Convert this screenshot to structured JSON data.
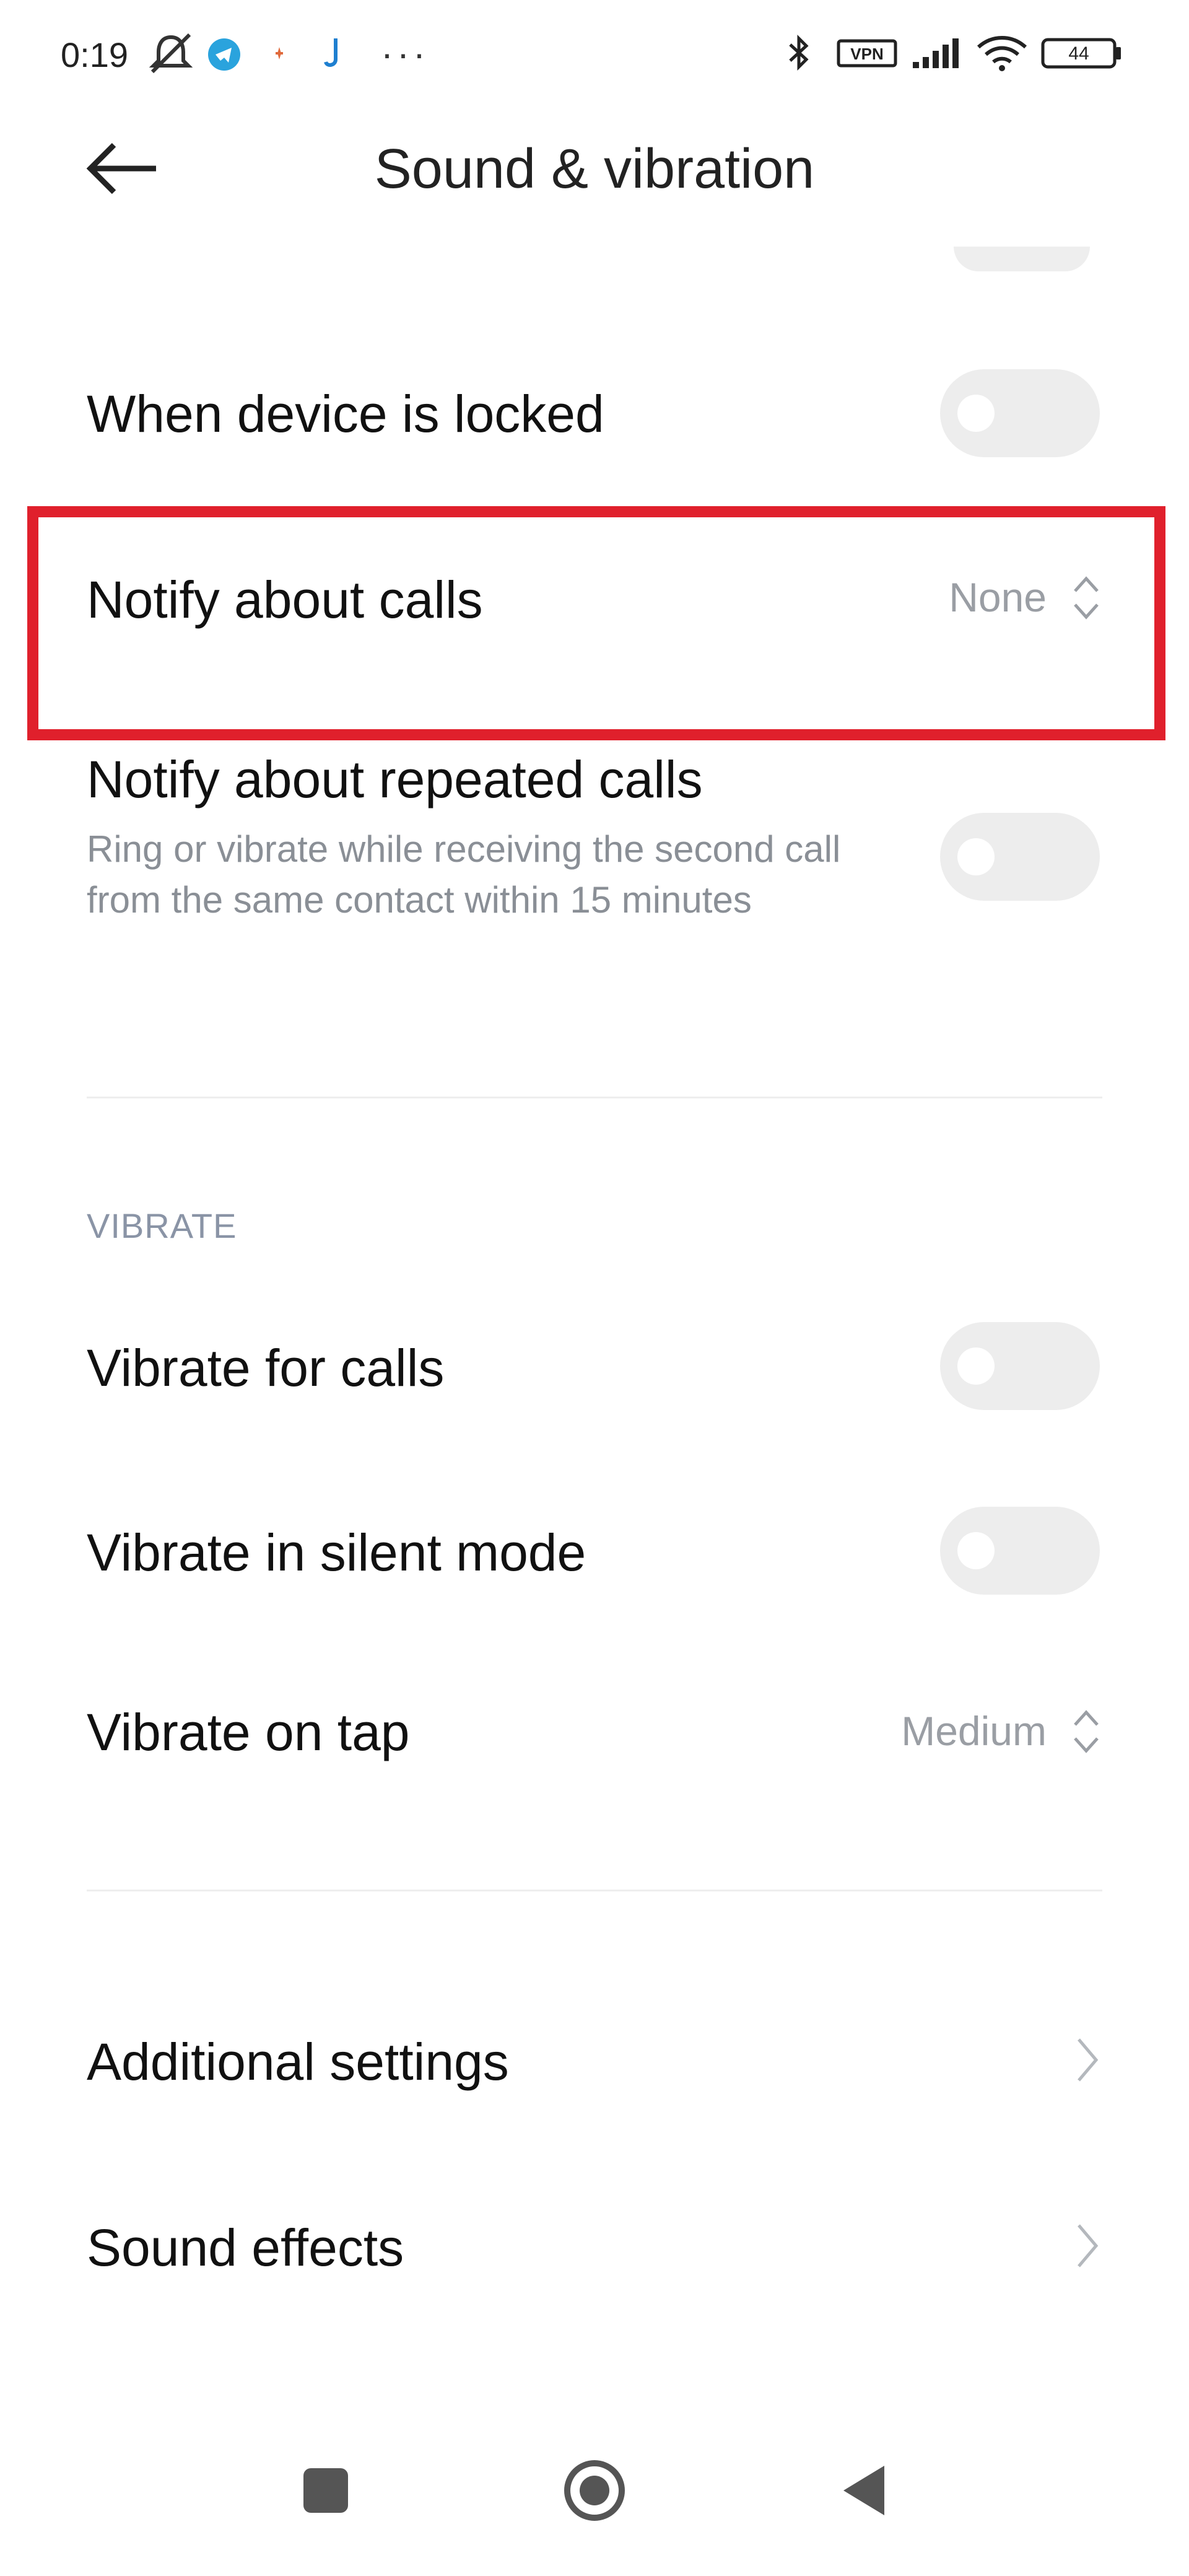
{
  "status_bar": {
    "time": "0:19",
    "vpn": "VPN",
    "battery": "44"
  },
  "header": {
    "title": "Sound & vibration"
  },
  "rows": {
    "when_locked": {
      "title": "When device is locked",
      "enabled": false
    },
    "notify_calls": {
      "title": "Notify about calls",
      "value": "None"
    },
    "notify_repeated": {
      "title": "Notify about repeated calls",
      "description": "Ring or vibrate while receiving the second call from the same contact within 15 minutes",
      "enabled": false
    }
  },
  "vibrate": {
    "section_label": "VIBRATE",
    "vibrate_calls": {
      "title": "Vibrate for calls",
      "enabled": false
    },
    "vibrate_silent": {
      "title": "Vibrate in silent mode",
      "enabled": false
    },
    "vibrate_tap": {
      "title": "Vibrate on tap",
      "value": "Medium"
    }
  },
  "more": {
    "additional": "Additional settings",
    "sound_effects": "Sound effects"
  },
  "colors": {
    "highlight": "#e0202c",
    "toggle_off": "#ededed",
    "secondary_text": "#9a9ea4"
  },
  "icons": [
    "mute-bell-icon",
    "telegram-icon",
    "notification-dot-icon",
    "music-note-icon",
    "more-dots-icon",
    "bluetooth-icon",
    "vpn-icon",
    "signal-icon",
    "wifi-icon",
    "battery-icon",
    "back-arrow-icon",
    "updown-icon",
    "chevron-right-icon",
    "nav-recents-icon",
    "nav-home-icon",
    "nav-back-icon"
  ]
}
